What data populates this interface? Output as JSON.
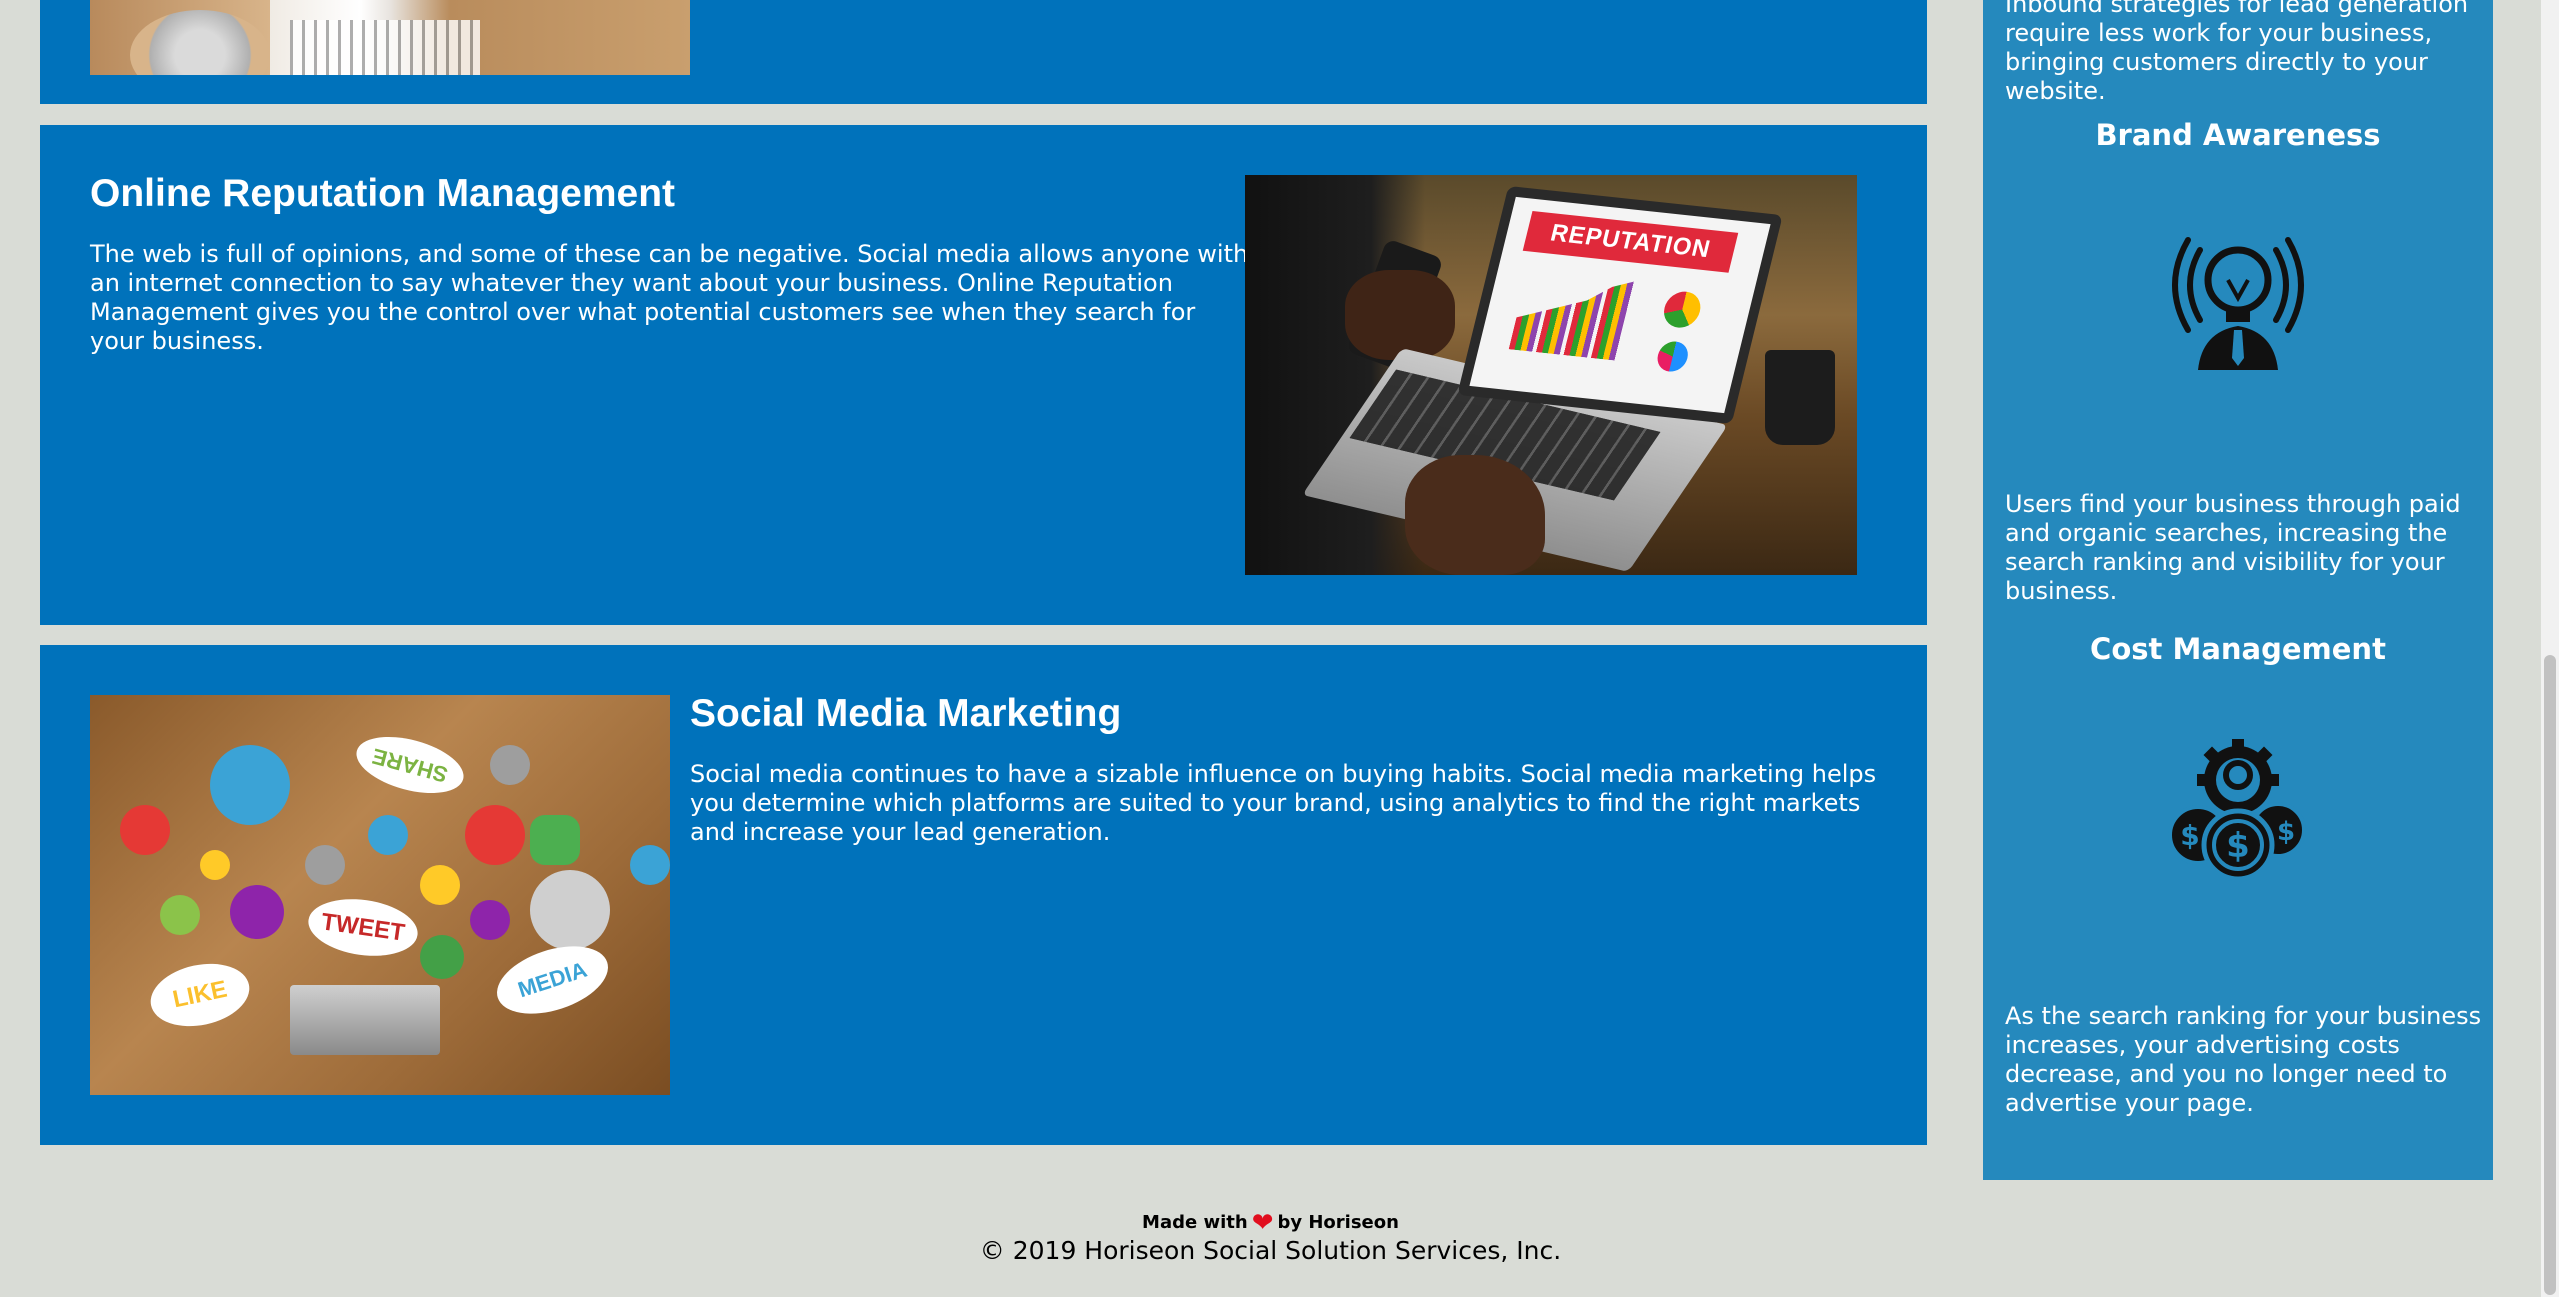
{
  "reputation": {
    "title": "Online Reputation Management",
    "text": "The web is full of opinions, and some of these can be negative. Social media allows anyone with an internet connection to say whatever they want about your business. Online Reputation Management gives you the control over what potential customers see when they search for your business.",
    "image_banner": "REPUTATION"
  },
  "social_media": {
    "title": "Social Media Marketing",
    "text": "Social media continues to have a sizable influence on buying habits. Social media marketing helps you determine which platforms are suited to your brand, using analytics to find the right markets and increase your lead generation.",
    "image_words": [
      "SHARE",
      "TWEET",
      "LIKE",
      "MEDIA"
    ]
  },
  "sidebar": {
    "lead_text": "Inbound strategies for lead generation require less work for your business, bringing customers directly to your website.",
    "brand": {
      "title": "Brand Awareness",
      "icon": "lightbulb-person-icon",
      "text": "Users find your business through paid and organic searches, increasing the search ranking and visibility for your business."
    },
    "cost": {
      "title": "Cost Management",
      "icon": "gear-coins-icon",
      "text": "As the search ranking for your business increases, your advertising costs decrease, and you no longer need to advertise your page."
    }
  },
  "footer": {
    "made_with": "Made with",
    "by": "by Horiseon",
    "heart_icon": "heart-icon",
    "copyright": "© 2019 Horiseon Social Solution Services, Inc."
  },
  "colors": {
    "page_bg": "#d9dcd6",
    "content_bg": "#0072bb",
    "sidebar_bg": "#2589bd",
    "heart": "#e10e1e"
  }
}
